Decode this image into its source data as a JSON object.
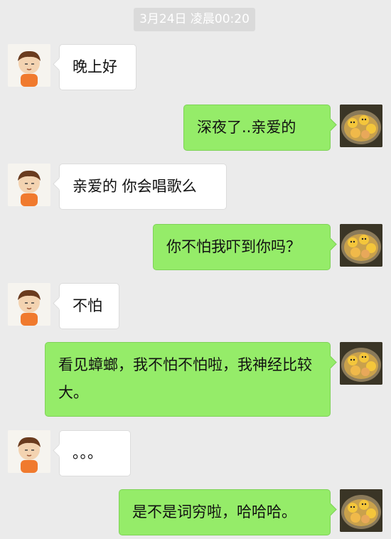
{
  "timestamp": "3月24日 凌晨00:20",
  "messages": [
    {
      "side": "left",
      "text": "晚上好",
      "avatar": "cartoon-boy-avatar"
    },
    {
      "side": "right",
      "text": "深夜了..亲爱的",
      "avatar": "food-bowl-avatar"
    },
    {
      "side": "left",
      "text": "亲爱的 你会唱歌么",
      "avatar": "cartoon-boy-avatar"
    },
    {
      "side": "right",
      "text": "你不怕我吓到你吗？",
      "avatar": "food-bowl-avatar"
    },
    {
      "side": "left",
      "text": "不怕",
      "avatar": "cartoon-boy-avatar"
    },
    {
      "side": "right",
      "text": "看见蟑螂，我不怕不怕啦，我神经比较大。",
      "avatar": "food-bowl-avatar"
    },
    {
      "side": "left",
      "text": "。。。",
      "avatar": "cartoon-boy-avatar"
    },
    {
      "side": "right",
      "text": "是不是词穷啦，哈哈哈。",
      "avatar": "food-bowl-avatar"
    }
  ],
  "colors": {
    "background": "#ebebeb",
    "incoming_bubble": "#ffffff",
    "outgoing_bubble": "#95ec69",
    "timestamp_bg": "#dadada"
  }
}
